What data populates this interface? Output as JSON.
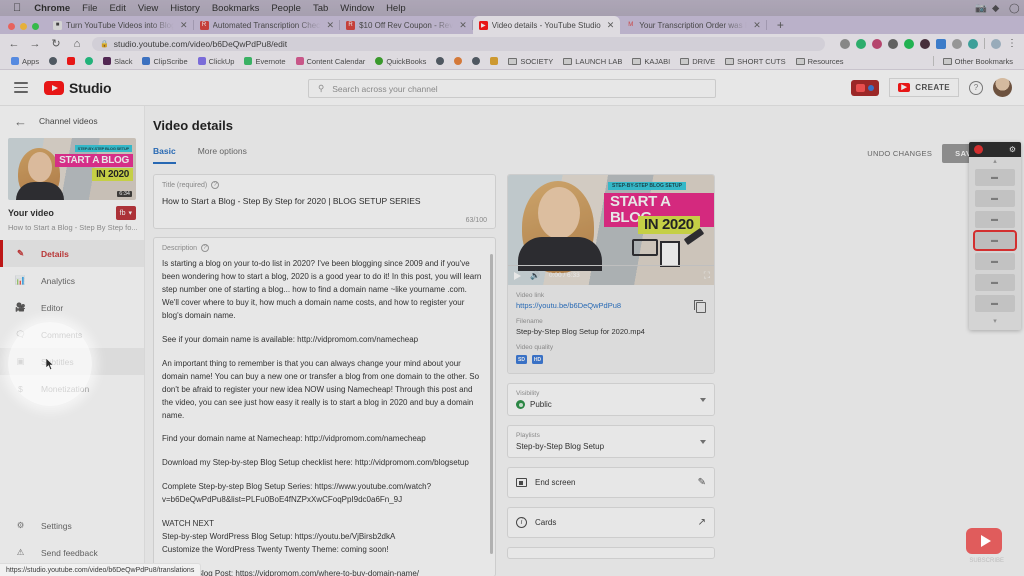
{
  "os_menu": {
    "apple_icon": "apple-logo",
    "items": [
      "Chrome",
      "File",
      "Edit",
      "View",
      "History",
      "Bookmarks",
      "People",
      "Tab",
      "Window",
      "Help"
    ],
    "status_icons": [
      "camera-icon",
      "dropbox-icon",
      "clock-icon"
    ]
  },
  "browser": {
    "tabs": [
      {
        "title": "Turn YouTube Videos into Blog P",
        "favicon": "document-icon",
        "active": false
      },
      {
        "title": "Automated Transcription Check",
        "favicon": "rev-icon",
        "active": false
      },
      {
        "title": "$10 Off Rev Coupon - Rev",
        "favicon": "rev-icon",
        "active": false
      },
      {
        "title": "Video details - YouTube Studio",
        "favicon": "youtube-icon",
        "active": true
      },
      {
        "title": "Your Transcription Order was Re",
        "favicon": "gmail-icon",
        "active": false
      }
    ],
    "new_tab_label": "+",
    "nav": {
      "back": "←",
      "forward": "→",
      "reload": "C",
      "home": "⌂"
    },
    "url": "studio.youtube.com/video/b6DeQwPdPu8/edit",
    "lock_icon": "lock-icon",
    "bookmarks": [
      {
        "label": "Apps",
        "icon": "apps-grid-icon"
      },
      {
        "label": "",
        "icon": "globe-icon"
      },
      {
        "label": "",
        "icon": "youtube-icon"
      },
      {
        "label": "",
        "icon": "green-circle-icon"
      },
      {
        "label": "Slack",
        "icon": "slack-icon"
      },
      {
        "label": "ClipScribe",
        "icon": "clipscribe-icon"
      },
      {
        "label": "ClickUp",
        "icon": "clickup-icon"
      },
      {
        "label": "Evernote",
        "icon": "evernote-icon"
      },
      {
        "label": "Content Calendar",
        "icon": "calendar-icon"
      },
      {
        "label": "QuickBooks",
        "icon": "quickbooks-icon"
      },
      {
        "label": "",
        "icon": "globe-icon"
      },
      {
        "label": "",
        "icon": "orange-icon"
      },
      {
        "label": "",
        "icon": "globe-icon"
      },
      {
        "label": "",
        "icon": "chart-icon"
      },
      {
        "label": "SOCIETY",
        "icon": "folder-icon"
      },
      {
        "label": "LAUNCH LAB",
        "icon": "folder-icon"
      },
      {
        "label": "KAJABI",
        "icon": "folder-icon"
      },
      {
        "label": "DRIVE",
        "icon": "folder-icon"
      },
      {
        "label": "SHORT CUTS",
        "icon": "folder-icon"
      },
      {
        "label": "Resources",
        "icon": "folder-icon"
      }
    ],
    "other_bookmarks": "Other Bookmarks",
    "status_url": "https://studio.youtube.com/video/b6DeQwPdPu8/translations"
  },
  "studio_header": {
    "menu_icon": "hamburger-icon",
    "logo_text": "Studio",
    "search_placeholder": "Search across your channel",
    "search_icon": "search-icon",
    "create_label": "CREATE",
    "help_icon": "question-mark-icon",
    "avatar": "user-avatar"
  },
  "sidebar": {
    "back_label": "Channel videos",
    "back_icon": "arrow-left-icon",
    "thumbnail": {
      "overline": "STEP-BY-STEP BLOG SETUP",
      "line1": "START A BLOG",
      "line2": "IN 2020",
      "duration": "6:34"
    },
    "your_video_label": "Your video",
    "video_title_short": "How to Start a Blog - Step By Step fo...",
    "badge_text": "fb",
    "items": [
      {
        "label": "Details",
        "icon": "pencil-icon",
        "active": true
      },
      {
        "label": "Analytics",
        "icon": "bar-chart-icon",
        "active": false
      },
      {
        "label": "Editor",
        "icon": "film-icon",
        "active": false
      },
      {
        "label": "Comments",
        "icon": "comment-icon",
        "active": false
      },
      {
        "label": "Subtitles",
        "icon": "subtitles-icon",
        "active": false
      },
      {
        "label": "Monetization",
        "icon": "dollar-icon",
        "active": false
      }
    ],
    "bottom_items": [
      {
        "label": "Settings",
        "icon": "gear-icon"
      },
      {
        "label": "Send feedback",
        "icon": "feedback-icon"
      }
    ]
  },
  "main": {
    "page_title": "Video details",
    "tabs": [
      {
        "label": "Basic",
        "selected": true
      },
      {
        "label": "More options",
        "selected": false
      }
    ],
    "undo_label": "UNDO CHANGES",
    "save_label": "SAVE",
    "overflow_icon": "kebab-menu-icon",
    "title_field": {
      "label": "Title (required)",
      "help_icon": "question-mark-icon",
      "value": "How to Start a Blog - Step By Step for 2020 | BLOG SETUP SERIES",
      "counter": "63/100"
    },
    "description_field": {
      "label": "Description",
      "help_icon": "question-mark-icon",
      "paragraphs": [
        "Is starting a blog on your to-do list in 2020? I've been blogging since 2009 and if you've been wondering how to start a blog, 2020 is a good year to do it! In this post, you will learn step number one of starting a blog... how to find a domain name ~like yourname .com. We'll cover where to buy it, how much a domain name costs, and how to register your blog's domain name.",
        "See if your domain name is available: http://vidpromom.com/namecheap",
        "An important thing to remember is that you can always change your mind about your domain name! You can buy a new one or transfer a blog from one domain to the other. So don't be afraid to register your new idea NOW using Namecheap! Through this post and the video, you can see just how easy it really is to start a blog in 2020 and buy a domain name.",
        "Find your domain name at Namecheap: http://vidpromom.com/namecheap",
        "Download my Step-by-step Blog Setup checklist here: http://vidpromom.com/blogsetup",
        "Complete Step-by-step Blog Setup Series: https://www.youtube.com/watch?v=b6DeQwPdPu8&list=PLFu0BoE4fNZPxXwCFoqPpI9dc0a6Fn_9J",
        "WATCH NEXT",
        "Step-by-step WordPress Blog Setup: https://youtu.be/VjBirsb2dkA",
        "Customize the WordPress Twenty Twenty Theme: coming soon!",
        "Read the Blog Post: https://vidpromom.com/where-to-buy-domain-name/"
      ]
    }
  },
  "right_panel": {
    "player": {
      "time": "0:00 / 6:33",
      "play_icon": "play-icon",
      "volume_icon": "volume-icon",
      "fullscreen_icon": "fullscreen-icon",
      "overline": "STEP-BY-STEP BLOG SETUP",
      "line1": "START A BLOG",
      "line2": "IN 2020"
    },
    "video_link": {
      "label": "Video link",
      "value": "https://youtu.be/b6DeQwPdPu8",
      "copy_icon": "copy-icon"
    },
    "filename": {
      "label": "Filename",
      "value": "Step-by-Step Blog Setup for 2020.mp4"
    },
    "video_quality": {
      "label": "Video quality",
      "badges": [
        "SD",
        "HD"
      ]
    },
    "visibility": {
      "label": "Visibility",
      "value": "Public",
      "icon": "eye-icon"
    },
    "playlists": {
      "label": "Playlists",
      "value": "Step-by-Step Blog Setup"
    },
    "end_screen": {
      "label": "End screen",
      "icon": "end-screen-icon",
      "action_icon": "pencil-icon"
    },
    "cards": {
      "label": "Cards",
      "icon": "info-icon",
      "action_icon": "external-link-icon"
    }
  },
  "rec_widget": {
    "record_icon": "record-icon",
    "settings_icon": "gear-icon",
    "scroll_up_icon": "chevron-up-icon",
    "scroll_down_icon": "chevron-down-icon",
    "buttons": [
      "item-1",
      "item-2",
      "item-3",
      "item-4",
      "item-5",
      "item-6",
      "item-7"
    ],
    "selected_index": 3
  },
  "overlays": {
    "subscribe_icon": "youtube-play-icon",
    "subscribe_text": "SUBSCRIBE"
  },
  "colors": {
    "youtube_red": "#ff0000",
    "accent_blue": "#1565c0",
    "active_nav": "#c62828",
    "record_red": "#d32f2f"
  }
}
